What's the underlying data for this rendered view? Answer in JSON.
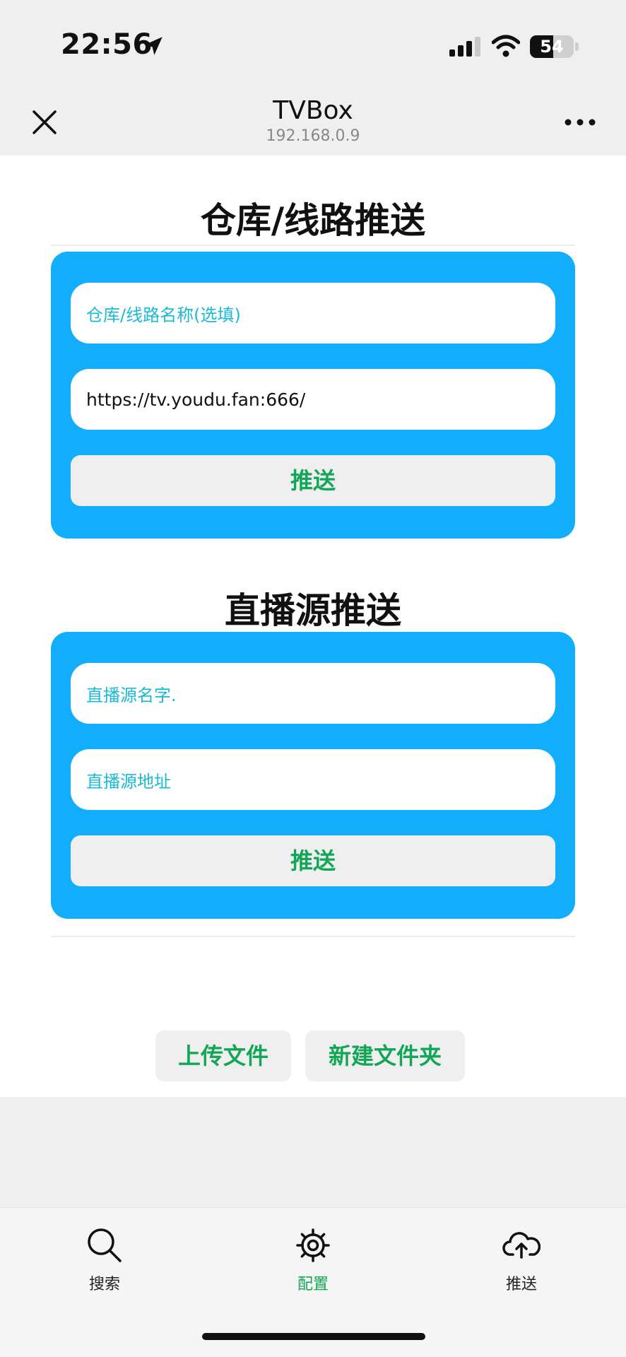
{
  "status_bar": {
    "time": "22:56",
    "battery": {
      "label": "54",
      "level": 0.54
    },
    "location_icon": "location-arrow-icon",
    "signal_icon": "cellular-signal-icon",
    "wifi_icon": "wifi-icon"
  },
  "header": {
    "title": "TVBox",
    "subtitle": "192.168.0.9",
    "close_icon": "close-icon",
    "more_icon": "more-icon"
  },
  "repo_section": {
    "title": "仓库/线路推送",
    "name_placeholder": "仓库/线路名称(选填)",
    "url_value": "https://tv.youdu.fan:666/",
    "push_label": "推送"
  },
  "live_section": {
    "title": "直播源推送",
    "name_placeholder": "直播源名字.",
    "url_placeholder": "直播源地址",
    "push_label": "推送"
  },
  "actions": {
    "upload_label": "上传文件",
    "new_folder_label": "新建文件夹"
  },
  "tab_bar": {
    "items": [
      {
        "label": "搜索",
        "icon": "search-icon",
        "active": false
      },
      {
        "label": "配置",
        "icon": "gear-icon",
        "active": true
      },
      {
        "label": "推送",
        "icon": "cloud-upload-icon",
        "active": false
      }
    ]
  },
  "colors": {
    "card_blue": "#12aefc",
    "accent_green": "#12a657",
    "placeholder_cyan": "#1ab9d6"
  }
}
